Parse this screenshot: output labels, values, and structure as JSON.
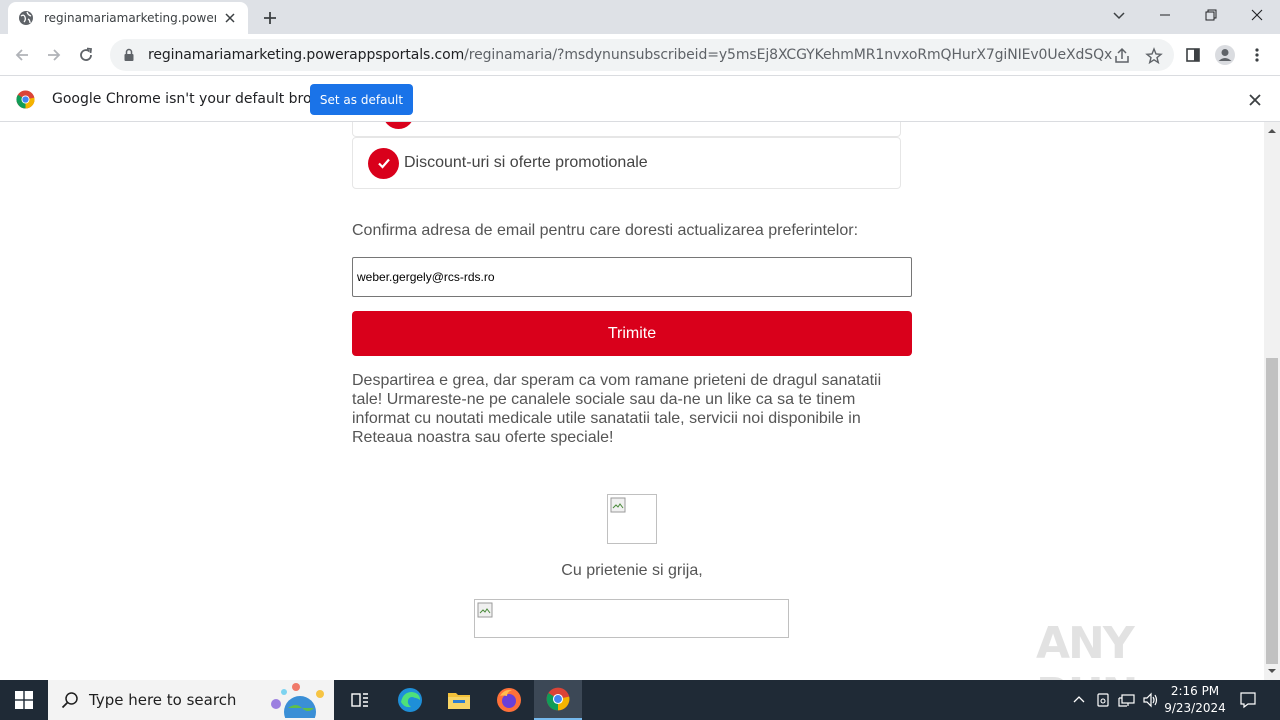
{
  "browser": {
    "tab_title": "reginamariamarketing.powerapps",
    "url_host": "reginamariamarketing.powerappsportals.com",
    "url_path": "/reginamaria/?msdynunsubscribeid=y5msEj8XCGYKehmMR1nvxoRmQHurX7giNIEv0UeXdSQx",
    "infobar_message": "Google Chrome isn't your default browser",
    "infobar_button": "Set as default"
  },
  "page": {
    "option_label": "Discount-uri si oferte promotionale",
    "confirm_label": "Confirma adresa de email pentru care doresti actualizarea preferintelor:",
    "email_value": "weber.gergely@rcs-rds.ro",
    "submit_label": "Trimite",
    "farewell_text": "Despartirea e grea, dar speram ca vom ramane prieteni de dragul sanatatii tale! Urmareste-ne pe canalele sociale sau da-ne un like ca sa te tinem informat cu noutati medicale utile sanatatii tale, servicii noi disponibile in Reteaua noastra sau oferte speciale!",
    "signoff": "Cu prietenie si grija,"
  },
  "watermark": {
    "text": "ANY RUN"
  },
  "taskbar": {
    "search_placeholder": "Type here to search",
    "time": "2:16 PM",
    "date": "9/23/2024"
  },
  "colors": {
    "brand_red": "#d9001b",
    "chrome_blue": "#1a73e8",
    "taskbar_bg": "#1f2a36"
  }
}
